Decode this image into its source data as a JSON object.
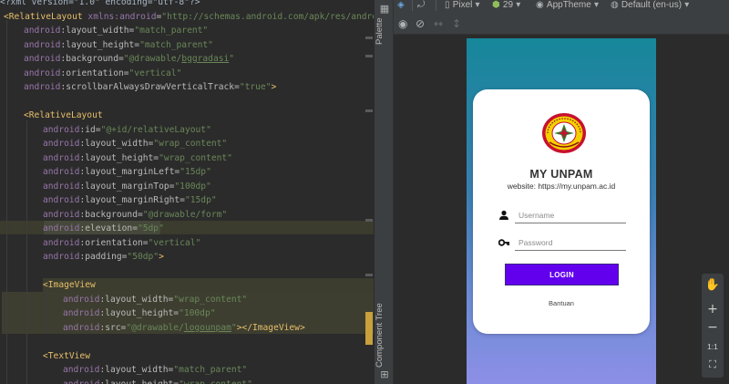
{
  "editor": {
    "lines": [
      [
        [
          "c-pi",
          "<?xml version=\"1.0\" encoding=\"utf-8\"?>"
        ]
      ],
      [
        [
          "c-tag",
          "<RelativeLayout "
        ],
        [
          "c-ns",
          "xmlns:android"
        ],
        [
          "c-attr",
          "="
        ],
        [
          "c-val",
          "\"http://schemas.android.com/apk/res/android\""
        ]
      ],
      [
        [
          "c-ns",
          "android"
        ],
        [
          "c-attr",
          ":layout_width="
        ],
        [
          "c-val",
          "\"match_parent\""
        ]
      ],
      [
        [
          "c-ns",
          "android"
        ],
        [
          "c-attr",
          ":layout_height="
        ],
        [
          "c-val",
          "\"match_parent\""
        ]
      ],
      [
        [
          "c-ns",
          "android"
        ],
        [
          "c-attr",
          ":background="
        ],
        [
          "c-val",
          "\"@drawable/"
        ],
        [
          "c-val c-under",
          "bggradasi"
        ],
        [
          "c-val",
          "\""
        ]
      ],
      [
        [
          "c-ns",
          "android"
        ],
        [
          "c-attr",
          ":orientation="
        ],
        [
          "c-val",
          "\"vertical\""
        ]
      ],
      [
        [
          "c-ns",
          "android"
        ],
        [
          "c-attr",
          ":scrollbarAlwaysDrawVerticalTrack="
        ],
        [
          "c-val",
          "\"true\""
        ],
        [
          "c-tag",
          ">"
        ]
      ],
      [],
      [
        [
          "c-tag",
          "<RelativeLayout"
        ]
      ],
      [
        [
          "c-ns",
          "android"
        ],
        [
          "c-attr",
          ":id="
        ],
        [
          "c-val",
          "\"@+id/relativeLayout\""
        ]
      ],
      [
        [
          "c-ns",
          "android"
        ],
        [
          "c-attr",
          ":layout_width="
        ],
        [
          "c-val",
          "\"wrap_content\""
        ]
      ],
      [
        [
          "c-ns",
          "android"
        ],
        [
          "c-attr",
          ":layout_height="
        ],
        [
          "c-val",
          "\"wrap_content\""
        ]
      ],
      [
        [
          "c-ns",
          "android"
        ],
        [
          "c-attr",
          ":layout_marginLeft="
        ],
        [
          "c-val",
          "\"15dp\""
        ]
      ],
      [
        [
          "c-ns",
          "android"
        ],
        [
          "c-attr",
          ":layout_marginTop="
        ],
        [
          "c-val",
          "\"100dp\""
        ]
      ],
      [
        [
          "c-ns",
          "android"
        ],
        [
          "c-attr",
          ":layout_marginRight="
        ],
        [
          "c-val",
          "\"15dp\""
        ]
      ],
      [
        [
          "c-ns",
          "android"
        ],
        [
          "c-attr",
          ":background="
        ],
        [
          "c-val",
          "\"@drawable/form\""
        ]
      ],
      [
        [
          "c-ns",
          "android"
        ],
        [
          "c-attr",
          ":elevation="
        ],
        [
          "c-val",
          "\"5dp\""
        ]
      ],
      [
        [
          "c-ns",
          "android"
        ],
        [
          "c-attr",
          ":orientation="
        ],
        [
          "c-val",
          "\"vertical\""
        ]
      ],
      [
        [
          "c-ns",
          "android"
        ],
        [
          "c-attr",
          ":padding="
        ],
        [
          "c-val",
          "\"50dp\""
        ],
        [
          "c-tag",
          ">"
        ]
      ],
      [],
      [
        [
          "c-tag",
          "<ImageView"
        ]
      ],
      [
        [
          "c-ns",
          "android"
        ],
        [
          "c-attr",
          ":layout_width="
        ],
        [
          "c-val",
          "\"wrap_content\""
        ]
      ],
      [
        [
          "c-ns",
          "android"
        ],
        [
          "c-attr",
          ":layout_height="
        ],
        [
          "c-val",
          "\"100dp\""
        ]
      ],
      [
        [
          "c-ns",
          "android"
        ],
        [
          "c-attr",
          ":src="
        ],
        [
          "c-val",
          "\"@drawable/"
        ],
        [
          "c-val c-under",
          "logounpam"
        ],
        [
          "c-val",
          "\""
        ],
        [
          "c-tag",
          "></ImageView>"
        ]
      ],
      [],
      [
        [
          "c-tag",
          "<TextView"
        ]
      ],
      [
        [
          "c-ns",
          "android"
        ],
        [
          "c-attr",
          ":layout_width="
        ],
        [
          "c-val",
          "\"match_parent\""
        ]
      ],
      [
        [
          "c-ns",
          "android"
        ],
        [
          "c-attr",
          ":layout_height="
        ],
        [
          "c-val",
          "\"wrap_content\""
        ]
      ]
    ]
  },
  "sidebar": {
    "palette_label": "Palette",
    "component_tree_label": "Component Tree"
  },
  "toolbar": {
    "device": "Pixel",
    "api_level": "29",
    "theme": "AppTheme",
    "locale": "Default (en-us)"
  },
  "preview": {
    "title": "MY UNPAM",
    "website": "website: https://my.unpam.ac.id",
    "username_placeholder": "Username",
    "password_placeholder": "Password",
    "login_label": "LOGIN",
    "help_label": "Bantuan",
    "colors": {
      "gradient_top": "#16879a",
      "gradient_bottom": "#8c8fe6",
      "button": "#6200ee",
      "logo_red": "#c8102e",
      "logo_yellow": "#f5d000"
    }
  },
  "zoom": {
    "plus": "+",
    "minus": "−",
    "one_to_one": "1:1"
  }
}
